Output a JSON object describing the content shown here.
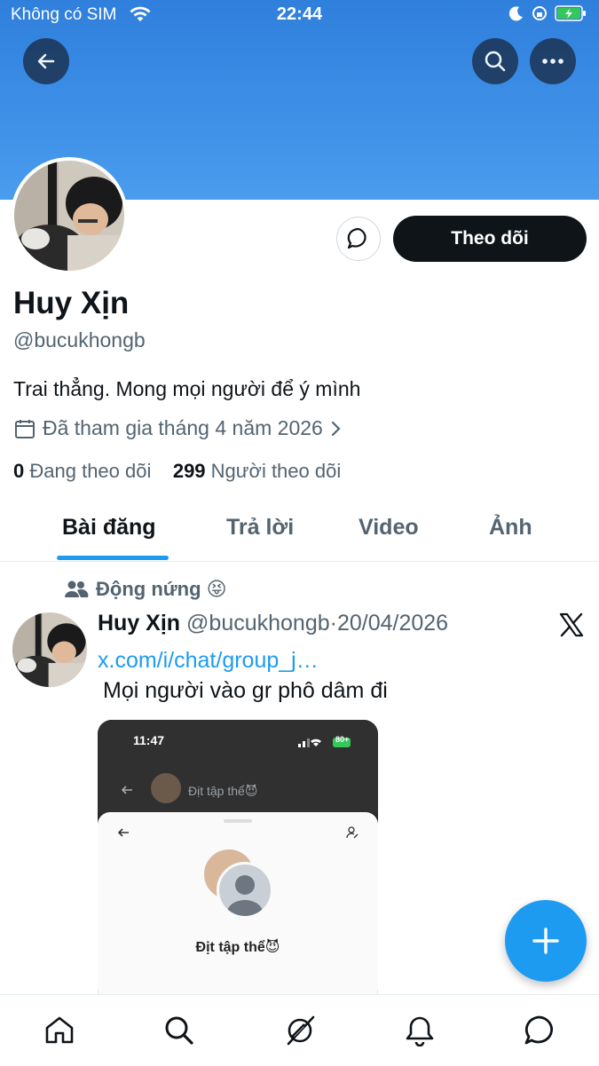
{
  "status_bar": {
    "carrier": "Không có SIM",
    "time": "22:44"
  },
  "header": {
    "back_icon": "arrow-left-icon",
    "search_icon": "search-icon",
    "more_icon": "more-dots-icon"
  },
  "profile": {
    "name": "Huy Xịn",
    "handle": "@bucukhongb",
    "bio": "Trai thẳng. Mong mọi người để ý mình",
    "joined": "Đã tham gia tháng 4 năm 2026",
    "following_count": "0",
    "following_label": "Đang theo dõi",
    "followers_count": "299",
    "followers_label": "Người theo dõi",
    "follow_button": "Theo dõi"
  },
  "tabs": [
    {
      "label": "Bài đăng",
      "active": true
    },
    {
      "label": "Trả lời",
      "active": false
    },
    {
      "label": "Video",
      "active": false
    },
    {
      "label": "Ảnh",
      "active": false
    }
  ],
  "post": {
    "repost_label": "Động nứng 😝",
    "author_name": "Huy Xịn",
    "author_handle": "@bucukhongb",
    "separator": "·",
    "date": "20/04/2026",
    "link": "x.com/i/chat/group_j…",
    "text": "Mọi người vào gr phô dâm đi",
    "image": {
      "time": "11:47",
      "battery": "80+",
      "group_name_top": "Địt tập thể😈",
      "group_name": "Địt tập thể😈"
    }
  },
  "colors": {
    "accent": "#1d9bf0",
    "banner": "#3d8fe6",
    "text": "#0f1419",
    "muted": "#536471"
  },
  "bottom_nav": [
    "home-icon",
    "search-icon",
    "grok-icon",
    "notifications-icon",
    "messages-icon"
  ]
}
